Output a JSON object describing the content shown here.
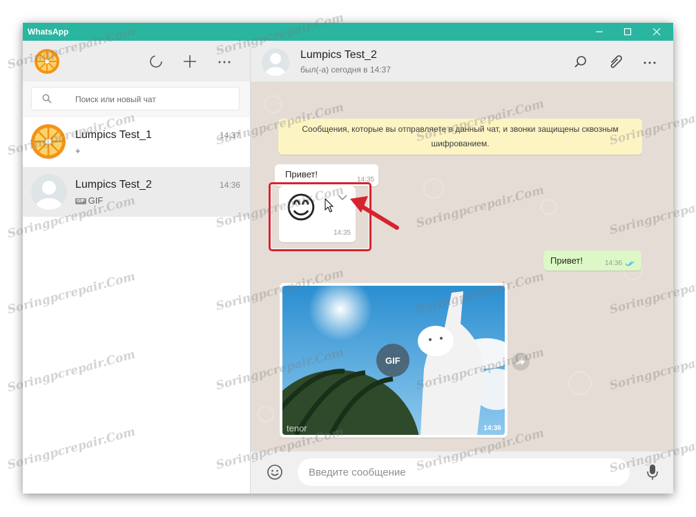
{
  "window": {
    "title": "WhatsApp"
  },
  "sidebar": {
    "search_placeholder": "Поиск или новый чат",
    "chats": [
      {
        "name": "Lumpics Test_1",
        "time": "14:37",
        "preview": "+"
      },
      {
        "name": "Lumpics Test_2",
        "time": "14:36",
        "preview_badge": "GIF",
        "preview": "GIF"
      }
    ]
  },
  "conversation": {
    "contact_name": "Lumpics Test_2",
    "contact_status": "был(-а) сегодня в 14:37",
    "system_message": "Сообщения, которые вы отправляете в данный чат, и звонки защищены сквозным шифрованием.",
    "messages": [
      {
        "direction": "in",
        "text": "Привет!",
        "time": "14:35"
      },
      {
        "direction": "in",
        "text": "😊",
        "time": "14:35"
      },
      {
        "direction": "out",
        "text": "Привет!",
        "time": "14:36"
      },
      {
        "direction": "in",
        "gif_label": "GIF",
        "provider": "tenor",
        "time": "14:36"
      }
    ],
    "input_placeholder": "Введите сообщение"
  },
  "watermark": "Soringpcrepair.Com",
  "colors": {
    "titlebar": "#2ab5a1",
    "annotation": "#d7232f",
    "out_bubble": "#dcf8c6",
    "system_bubble": "#fdf4c4"
  }
}
